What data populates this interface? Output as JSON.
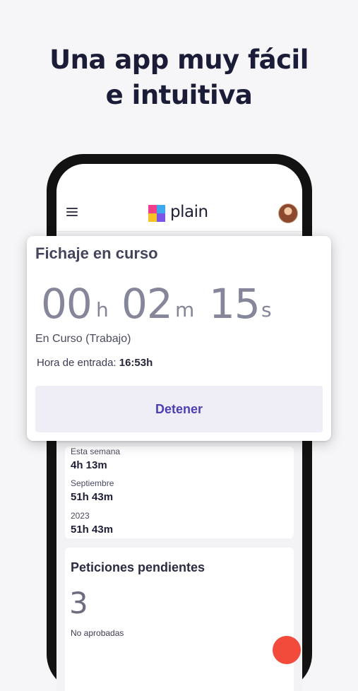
{
  "headline": {
    "line1": "Una app muy fácil",
    "line2": "e intuitiva"
  },
  "app": {
    "logo_text": "plain",
    "logo_colors": [
      "#f03e8a",
      "#f7c325",
      "#3ea8ec",
      "#7a55e8"
    ]
  },
  "clock_card": {
    "title": "Fichaje en curso",
    "hours": "00",
    "hours_unit": "h",
    "minutes": "02",
    "minutes_unit": "m",
    "seconds": "15",
    "seconds_unit": "s",
    "status": "En Curso (Trabajo)",
    "entry_label": "Hora de entrada:",
    "entry_time": "16:53h",
    "stop_button": "Detener"
  },
  "stats": [
    {
      "label": "Esta semana",
      "value": "4h 13m"
    },
    {
      "label": "Septiembre",
      "value": "51h 43m"
    },
    {
      "label": "2023",
      "value": "51h 43m"
    }
  ],
  "requests": {
    "title": "Peticiones pendientes",
    "count": "3",
    "caption": "No aprobadas"
  },
  "colors": {
    "accent": "#4b3fb6",
    "fab": "#f24b3c"
  }
}
